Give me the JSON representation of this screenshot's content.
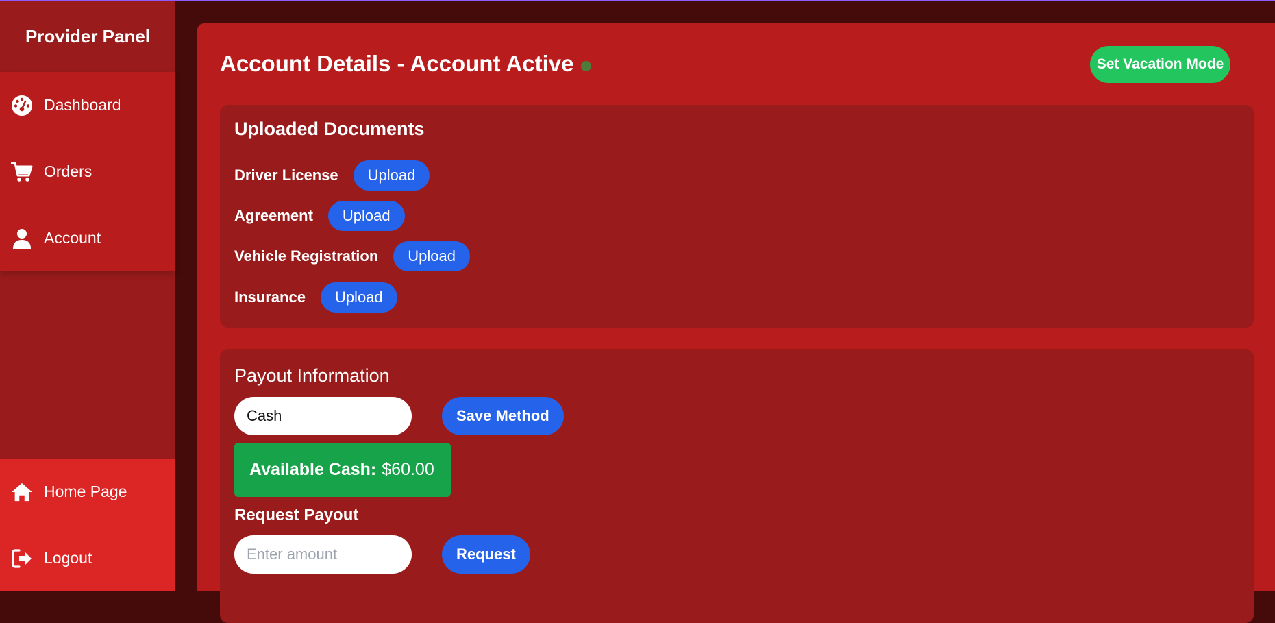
{
  "sidebar": {
    "brand": "Provider Panel",
    "items": [
      {
        "label": "Dashboard",
        "icon": "dashboard-gauge-icon"
      },
      {
        "label": "Orders",
        "icon": "cart-icon"
      },
      {
        "label": "Account",
        "icon": "user-icon"
      }
    ],
    "bottom_items": [
      {
        "label": "Home Page",
        "icon": "home-icon"
      },
      {
        "label": "Logout",
        "icon": "logout-icon"
      }
    ]
  },
  "header": {
    "title": "Account Details - Account Active",
    "status_color": "#4d7c3b",
    "vacation_button": "Set Vacation Mode"
  },
  "documents": {
    "title": "Uploaded Documents",
    "items": [
      {
        "label": "Driver License",
        "button": "Upload"
      },
      {
        "label": "Agreement",
        "button": "Upload"
      },
      {
        "label": "Vehicle Registration",
        "button": "Upload"
      },
      {
        "label": "Insurance",
        "button": "Upload"
      }
    ]
  },
  "payout": {
    "title": "Payout Information",
    "method_value": "Cash",
    "save_button": "Save Method",
    "available_label": "Available Cash:",
    "available_amount": "$60.00",
    "request_title": "Request Payout",
    "amount_placeholder": "Enter amount",
    "request_button": "Request"
  },
  "colors": {
    "sidebar_bg": "#991b1b",
    "main_bg": "#b91c1c",
    "card_bg": "#991b1b",
    "primary_button": "#2563eb",
    "success": "#22c55e",
    "cash_box": "#16a34a"
  }
}
